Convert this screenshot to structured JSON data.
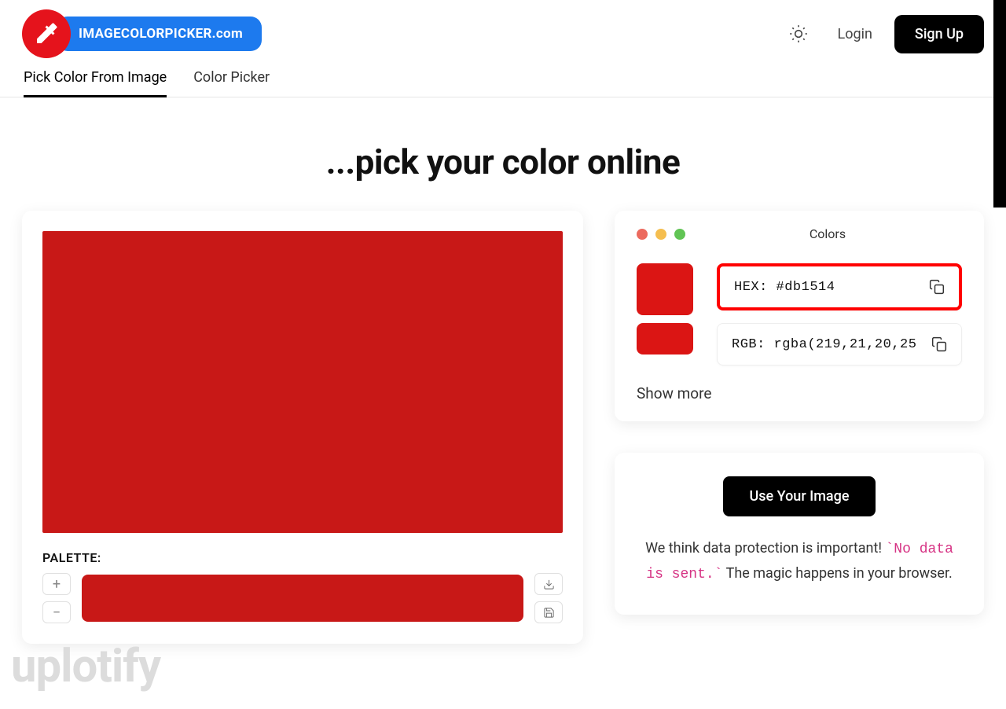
{
  "brand": {
    "text": "IMAGECOLORPICKER.com"
  },
  "header": {
    "login": "Login",
    "signup": "Sign Up"
  },
  "tabs": [
    {
      "label": "Pick Color From Image",
      "active": true
    },
    {
      "label": "Color Picker",
      "active": false
    }
  ],
  "hero": "...pick your color online",
  "palette": {
    "label": "PALETTE:",
    "plus": "+",
    "minus": "−"
  },
  "colors_panel": {
    "title": "Colors",
    "hex_label": "HEX:",
    "hex_value": "#db1514",
    "rgb_label": "RGB:",
    "rgb_value": "rgba(219,21,20,25",
    "show_more": "Show more"
  },
  "use_panel": {
    "button": "Use Your Image",
    "desc_a": "We think data protection is important! ",
    "desc_code": "`No data is sent.`",
    "desc_b": " The magic happens in your browser."
  },
  "swatches": {
    "canvas_color": "#c81817",
    "selected_color": "#db1514"
  },
  "watermark": "uplotify"
}
